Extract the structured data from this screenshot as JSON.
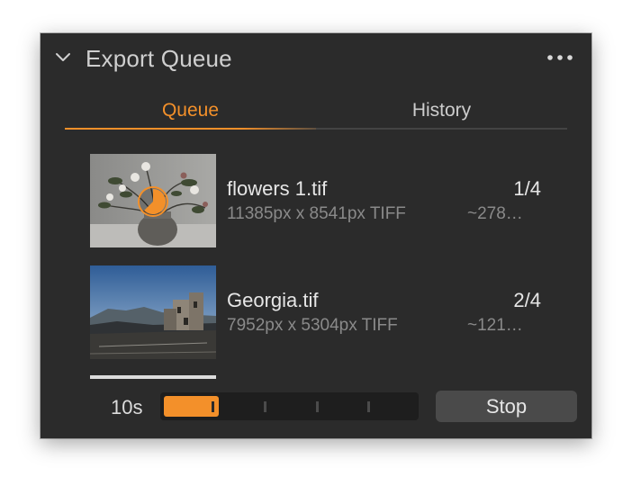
{
  "panel": {
    "title": "Export Queue",
    "collapse_icon": "chevron-down-icon",
    "more_icon": "more-horizontal-icon"
  },
  "tabs": [
    {
      "label": "Queue",
      "active": true
    },
    {
      "label": "History",
      "active": false
    }
  ],
  "queue": {
    "items": [
      {
        "filename": "flowers 1.tif",
        "position": "1/4",
        "dimensions": "11385px x 8541px TIFF",
        "size": "~278…",
        "progress_percent": 62.5,
        "thumbnail": "flowers-in-vase-photo"
      },
      {
        "filename": "Georgia.tif",
        "position": "2/4",
        "dimensions": "7952px x 5304px TIFF",
        "size": "~121…",
        "thumbnail": "stone-tower-landscape-photo"
      }
    ]
  },
  "footer": {
    "time_remaining": "10s",
    "overall_progress_percent": 22,
    "stop_label": "Stop"
  },
  "colors": {
    "accent": "#f3902a",
    "panel_bg": "#2b2b2b",
    "text_primary": "#e6e6e6",
    "text_secondary": "#8a8a8a"
  }
}
